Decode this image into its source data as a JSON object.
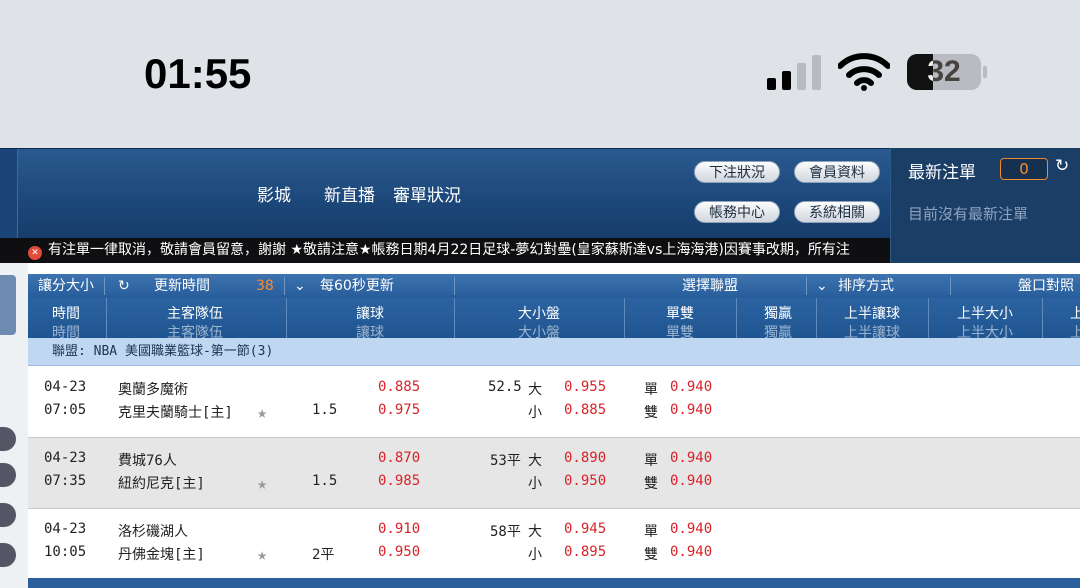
{
  "status_bar": {
    "time": "01:55",
    "battery": "32"
  },
  "nav": {
    "links": [
      "影城",
      "新直播",
      "審單狀況"
    ],
    "buttons": [
      "下注狀況",
      "會員資料",
      "帳務中心",
      "系統相關"
    ]
  },
  "ticker": {
    "icon": "✕",
    "text": "有注單一律取消，敬請會員留意，謝謝 ★敬請注意★帳務日期4月22日足球-夢幻對壘(皇家蘇斯達vs上海海港)因賽事改期，所有注"
  },
  "latest_bets": {
    "title": "最新注單",
    "count": "0",
    "refresh_icon": "↻",
    "empty_text": "目前沒有最新注單"
  },
  "filter_bar": {
    "odds_type": "讓分大小",
    "refresh_icon": "↻",
    "update_time_label": "更新時間",
    "countdown": "38",
    "dropdown_icon": "⌄",
    "interval": "每60秒更新",
    "league_select": "選擇聯盟",
    "sort_dropdown_icon": "⌄",
    "sort": "排序方式",
    "compare": "盤口對照表"
  },
  "columns": [
    "時間",
    "主客隊伍",
    "讓球",
    "大小盤",
    "單雙",
    "獨贏",
    "上半讓球",
    "上半大小",
    "上"
  ],
  "league": "聯盟: NBA 美國職業籃球-第一節(3)",
  "matches": [
    {
      "date": "04-23",
      "time": "07:05",
      "away": "奧蘭多魔術",
      "home": "克里夫蘭騎士[主]",
      "handicap": "1.5",
      "hdp_away_odds": "0.885",
      "hdp_home_odds": "0.975",
      "total_line": "52.5",
      "over_label": "大",
      "under_label": "小",
      "over_odds": "0.955",
      "under_odds": "0.885",
      "odd_label": "單",
      "even_label": "雙",
      "odd_odds": "0.940",
      "even_odds": "0.940"
    },
    {
      "date": "04-23",
      "time": "07:35",
      "away": "費城76人",
      "home": "紐約尼克[主]",
      "handicap": "1.5",
      "hdp_away_odds": "0.870",
      "hdp_home_odds": "0.985",
      "total_line": "53平",
      "over_label": "大",
      "under_label": "小",
      "over_odds": "0.890",
      "under_odds": "0.950",
      "odd_label": "單",
      "even_label": "雙",
      "odd_odds": "0.940",
      "even_odds": "0.940"
    },
    {
      "date": "04-23",
      "time": "10:05",
      "away": "洛杉磯湖人",
      "home": "丹佛金塊[主]",
      "handicap": "2平",
      "hdp_away_odds": "0.910",
      "hdp_home_odds": "0.950",
      "total_line": "58平",
      "over_label": "大",
      "under_label": "小",
      "over_odds": "0.945",
      "under_odds": "0.895",
      "odd_label": "單",
      "even_label": "雙",
      "odd_odds": "0.940",
      "even_odds": "0.940"
    }
  ],
  "colors": {
    "nav_bg": "#1c4779",
    "header_bg": "#275d9a",
    "league_bg": "#bfd7f0",
    "odds_red": "#d8232a",
    "row_alt": "#e6e6e6"
  }
}
